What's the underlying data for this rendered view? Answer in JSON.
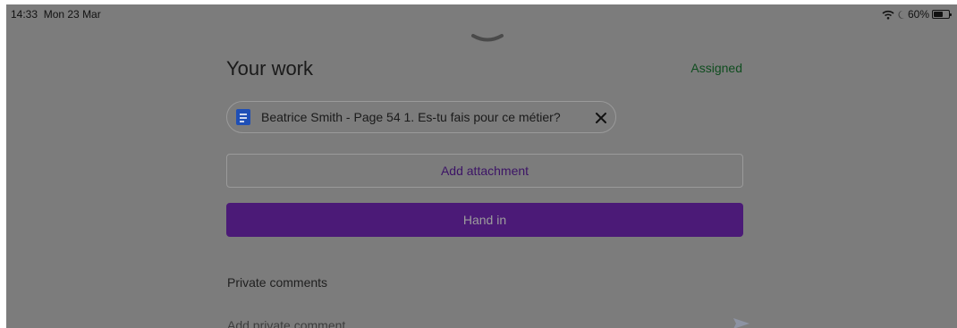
{
  "status_bar": {
    "time": "14:33",
    "date": "Mon 23 Mar",
    "battery_label": "60%",
    "battery_level": 0.6,
    "icons": [
      "wifi-icon",
      "moon-icon",
      "battery-icon"
    ]
  },
  "sheet": {
    "grabber_icon": "chevron-down-icon",
    "title": "Your work",
    "status": "Assigned",
    "status_color": "#0f4d1f"
  },
  "attachment": {
    "icon": "google-docs-icon",
    "name": "Beatrice Smith - Page 54 1. Es-tu fais pour ce métier?",
    "remove_icon": "close-icon"
  },
  "actions": {
    "add_attachment": "Add attachment",
    "hand_in": "Hand in",
    "accent_color": "#4b1a77"
  },
  "comments": {
    "section_label": "Private comments",
    "input_placeholder": "Add private comment",
    "send_icon": "send-icon"
  }
}
